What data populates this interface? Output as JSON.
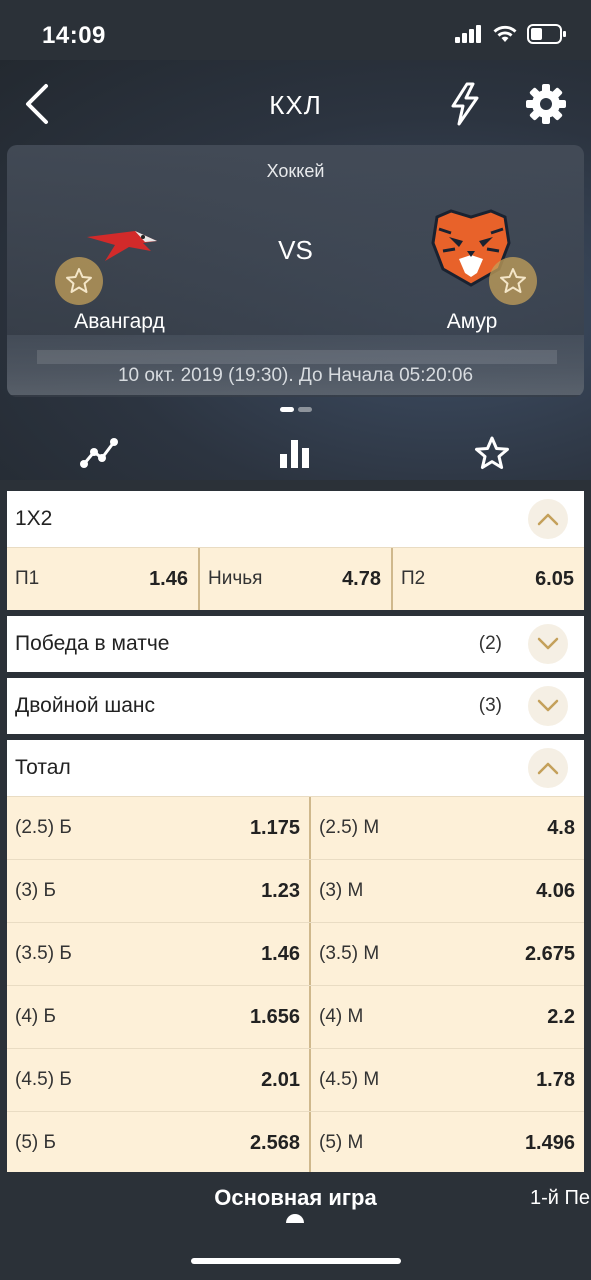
{
  "status": {
    "time": "14:09"
  },
  "header": {
    "title": "КХЛ"
  },
  "match": {
    "sport": "Хоккей",
    "team1": "Авангард",
    "team2": "Амур",
    "vs": "VS",
    "datetime": "10 окт. 2019 (19:30). До Начала  05:20:06"
  },
  "markets": {
    "onextwo": {
      "title": "1X2",
      "p1_label": "П1",
      "p1_value": "1.46",
      "draw_label": "Ничья",
      "draw_value": "4.78",
      "p2_label": "П2",
      "p2_value": "6.05"
    },
    "win": {
      "title": "Победа в матче",
      "count": "(2)"
    },
    "double": {
      "title": "Двойной шанс",
      "count": "(3)"
    },
    "total": {
      "title": "Тотал",
      "rows": [
        {
          "over_label": "(2.5) Б",
          "over_value": "1.175",
          "under_label": "(2.5) М",
          "under_value": "4.8"
        },
        {
          "over_label": "(3) Б",
          "over_value": "1.23",
          "under_label": "(3) М",
          "under_value": "4.06"
        },
        {
          "over_label": "(3.5) Б",
          "over_value": "1.46",
          "under_label": "(3.5) М",
          "under_value": "2.675"
        },
        {
          "over_label": "(4) Б",
          "over_value": "1.656",
          "under_label": "(4) М",
          "under_value": "2.2"
        },
        {
          "over_label": "(4.5) Б",
          "over_value": "2.01",
          "under_label": "(4.5) М",
          "under_value": "1.78"
        },
        {
          "over_label": "(5) Б",
          "over_value": "2.568",
          "under_label": "(5) М",
          "under_value": "1.496"
        }
      ]
    }
  },
  "bottom": {
    "main_tab": "Основная игра",
    "next_tab": "1-й Пе"
  },
  "colors": {
    "accent": "#c4a05a",
    "row_bg": "#fdf0d8",
    "dark_bg": "#2b3138"
  }
}
